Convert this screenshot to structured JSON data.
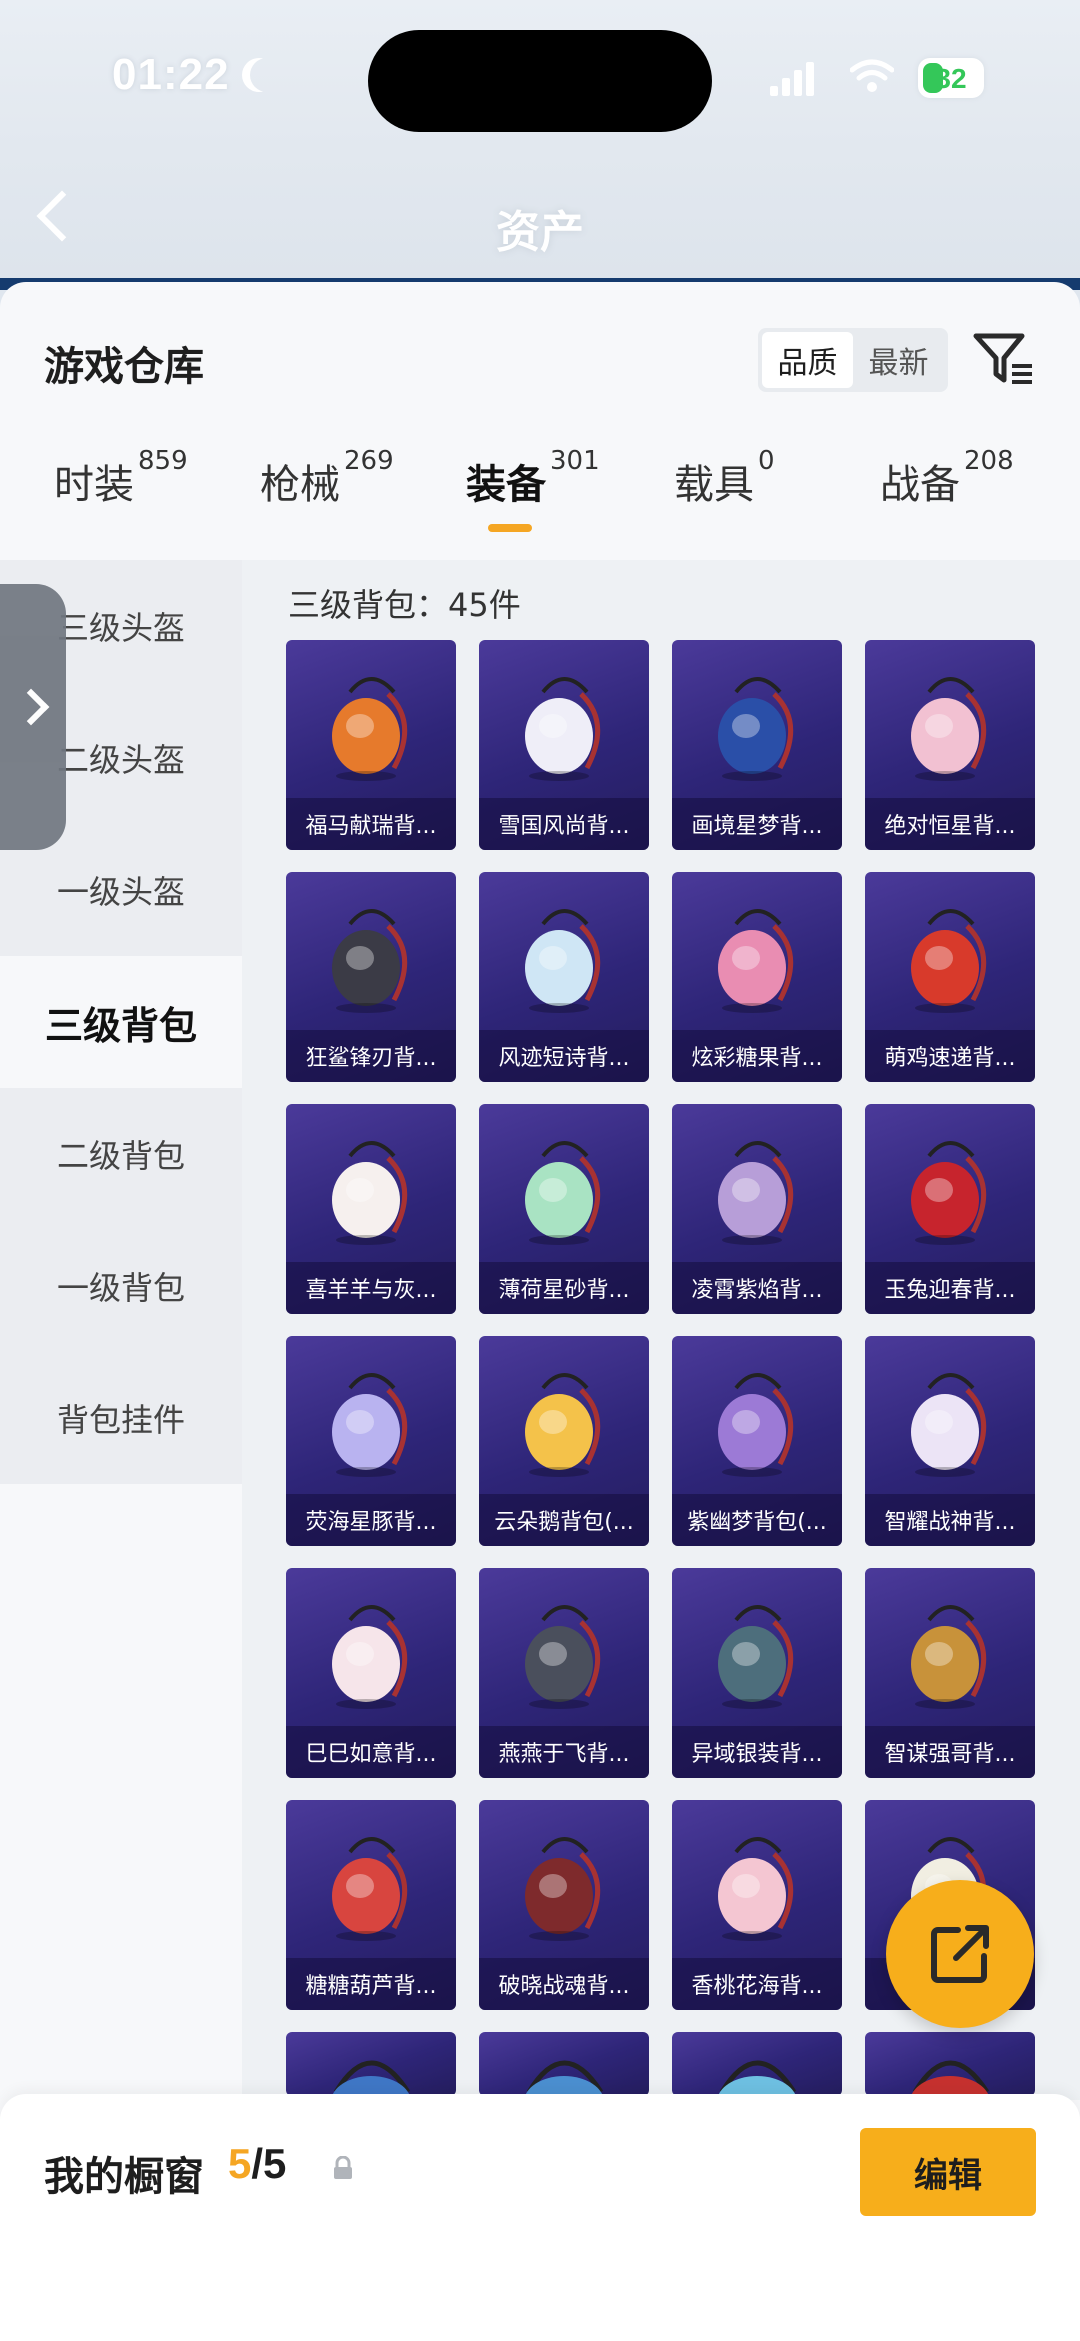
{
  "status": {
    "time": "01:22",
    "battery": "32"
  },
  "nav": {
    "title": "资产"
  },
  "header": {
    "title": "游戏仓库",
    "sort_options": [
      "品质",
      "最新"
    ],
    "sort_active": "品质"
  },
  "tabs": [
    {
      "label": "时装",
      "count": "859"
    },
    {
      "label": "枪械",
      "count": "269"
    },
    {
      "label": "装备",
      "count": "301",
      "active": true
    },
    {
      "label": "载具",
      "count": "0"
    },
    {
      "label": "战备",
      "count": "208"
    }
  ],
  "sidebar": {
    "items": [
      "三级头盔",
      "二级头盔",
      "一级头盔",
      "三级背包",
      "二级背包",
      "一级背包",
      "背包挂件"
    ],
    "active": "三级背包"
  },
  "section": {
    "label": "三级背包：45件"
  },
  "items": [
    {
      "name": "福马献瑞背...",
      "color": "#e67a2c"
    },
    {
      "name": "雪国风尚背...",
      "color": "#efeef8"
    },
    {
      "name": "画境星梦背...",
      "color": "#2a4fa8"
    },
    {
      "name": "绝对恒星背...",
      "color": "#f2c1d2"
    },
    {
      "name": "狂鲨锋刃背...",
      "color": "#3b3b46"
    },
    {
      "name": "风迹短诗背...",
      "color": "#cfe6f5"
    },
    {
      "name": "炫彩糖果背...",
      "color": "#e98db2"
    },
    {
      "name": "萌鸡速递背...",
      "color": "#d83a2b"
    },
    {
      "name": "喜羊羊与灰...",
      "color": "#f6f0ee"
    },
    {
      "name": "薄荷星砂背...",
      "color": "#a9e3c3"
    },
    {
      "name": "凌霄紫焰背...",
      "color": "#b79ed8"
    },
    {
      "name": "玉兔迎春背...",
      "color": "#c7242d"
    },
    {
      "name": "荧海星豚背...",
      "color": "#b9b3f0"
    },
    {
      "name": "云朵鹅背包(...",
      "color": "#f4c24a"
    },
    {
      "name": "紫幽梦背包(...",
      "color": "#9c7ad6"
    },
    {
      "name": "智耀战神背...",
      "color": "#ece4f6"
    },
    {
      "name": "巳巳如意背...",
      "color": "#f6e5ea"
    },
    {
      "name": "燕燕于飞背...",
      "color": "#4a4f5c"
    },
    {
      "name": "异域银装背...",
      "color": "#4d6e7c"
    },
    {
      "name": "智谋强哥背...",
      "color": "#c8923a"
    },
    {
      "name": "糖糖葫芦背...",
      "color": "#d8453f"
    },
    {
      "name": "破晓战魂背...",
      "color": "#7e2a2c"
    },
    {
      "name": "香桃花海背...",
      "color": "#f4c6d2"
    },
    {
      "name": "",
      "color": "#f1eee2"
    }
  ],
  "partial_row_colors": [
    "#3f77c6",
    "#4b8fd0",
    "#6ec0e2",
    "#c6312f"
  ],
  "bottom": {
    "showcase_label": "我的橱窗",
    "showcase_current": "5",
    "showcase_sep": "/",
    "showcase_max": "5",
    "edit_label": "编辑"
  },
  "colors": {
    "accent": "#f5a623",
    "button": "#f7ae1b",
    "card_top": "#4b3a9a",
    "card_bottom": "#241d5e"
  }
}
